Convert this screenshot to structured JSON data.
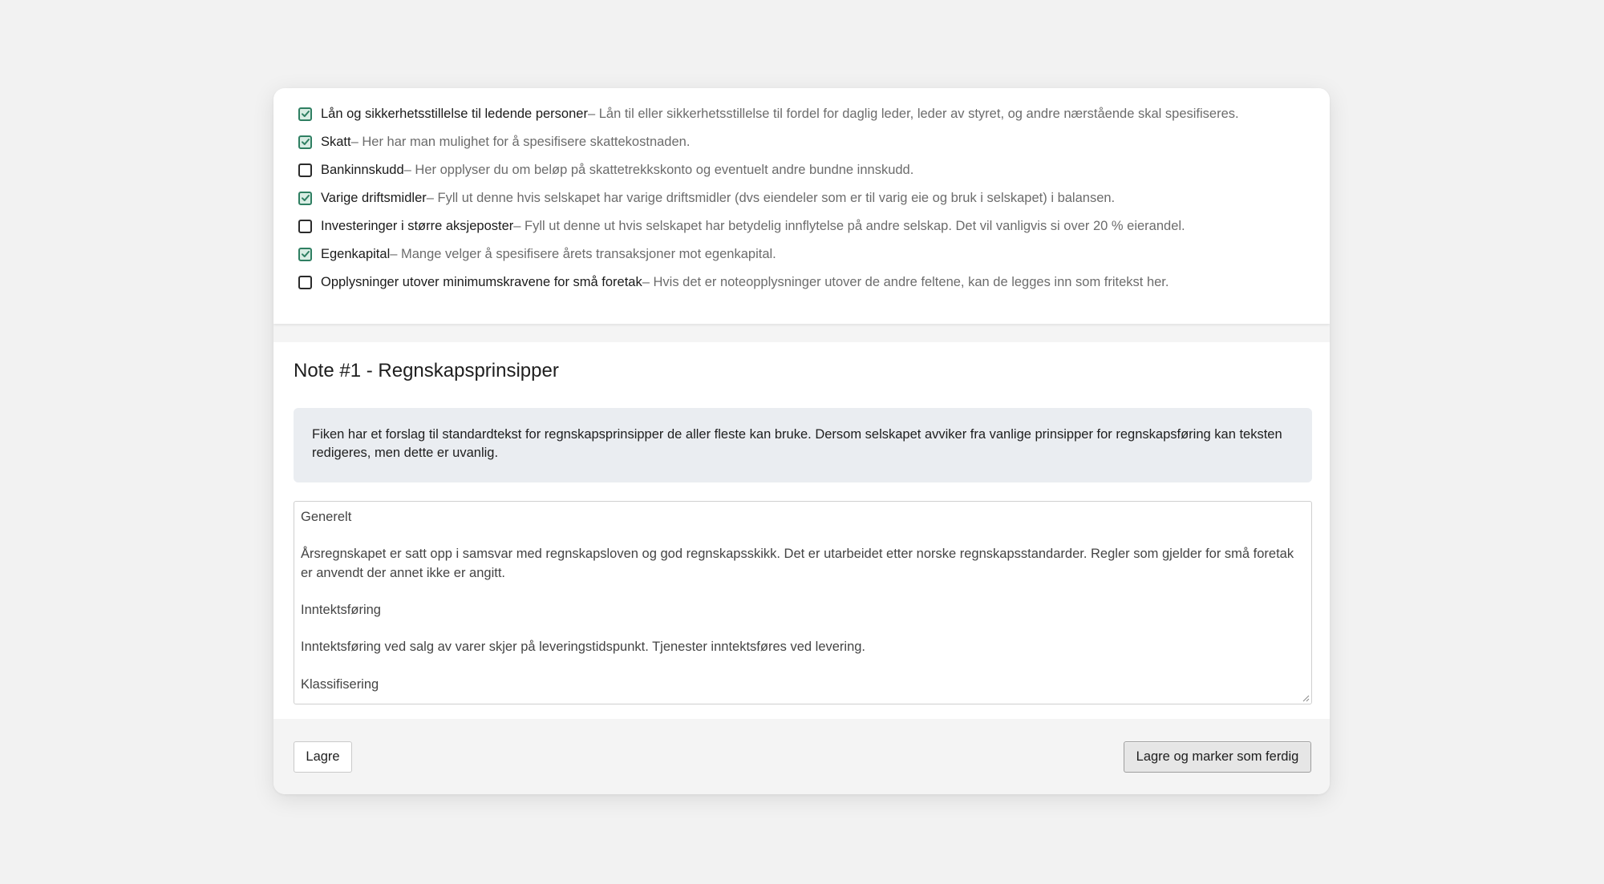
{
  "checklist": [
    {
      "title": "Lån og sikkerhetsstillelse til ledende personer",
      "desc": " – Lån til eller sikkerhetsstillelse til fordel for daglig leder, leder av styret, og andre nærstående skal spesifiseres.",
      "checked": true
    },
    {
      "title": "Skatt",
      "desc": " – Her har man mulighet for å spesifisere skattekostnaden.",
      "checked": true
    },
    {
      "title": "Bankinnskudd",
      "desc": " – Her opplyser du om beløp på skattetrekkskonto og eventuelt andre bundne innskudd.",
      "checked": false
    },
    {
      "title": "Varige driftsmidler",
      "desc": " – Fyll ut denne hvis selskapet har varige driftsmidler (dvs eiendeler som er til varig eie og bruk i selskapet) i balansen.",
      "checked": true
    },
    {
      "title": "Investeringer i større aksjeposter",
      "desc": " – Fyll ut denne ut hvis selskapet har betydelig innflytelse på andre selskap. Det vil vanligvis si over 20 % eierandel.",
      "checked": false
    },
    {
      "title": "Egenkapital",
      "desc": " – Mange velger å spesifisere årets transaksjoner mot egenkapital.",
      "checked": true
    },
    {
      "title": "Opplysninger utover minimumskravene for små foretak",
      "desc": " – Hvis det er noteopplysninger utover de andre feltene, kan de legges inn som fritekst her.",
      "checked": false
    }
  ],
  "note": {
    "title": "Note #1 - Regnskapsprinsipper",
    "info": "Fiken har et forslag til standardtekst for regnskapsprinsipper de aller fleste kan bruke. Dersom selskapet avviker fra vanlige prinsipper for regnskapsføring kan teksten redigeres, men dette er uvanlig.",
    "textarea_lines": [
      "Generelt",
      "",
      "Årsregnskapet er satt opp i samsvar med regnskapsloven og god regnskapsskikk. Det er utarbeidet etter norske regnskapsstandarder. Regler som gjelder for små foretak er anvendt der annet ikke er angitt.",
      "",
      "Inntektsføring",
      "",
      "Inntektsføring ved salg av varer skjer på leveringstidspunkt. Tjenester inntektsføres ved levering.",
      "",
      "Klassifisering"
    ]
  },
  "footer": {
    "save_label": "Lagre",
    "finish_label": "Lagre og marker som ferdig"
  },
  "colors": {
    "check_accent": "#2f7f62",
    "info_bg": "#eaedf1"
  }
}
